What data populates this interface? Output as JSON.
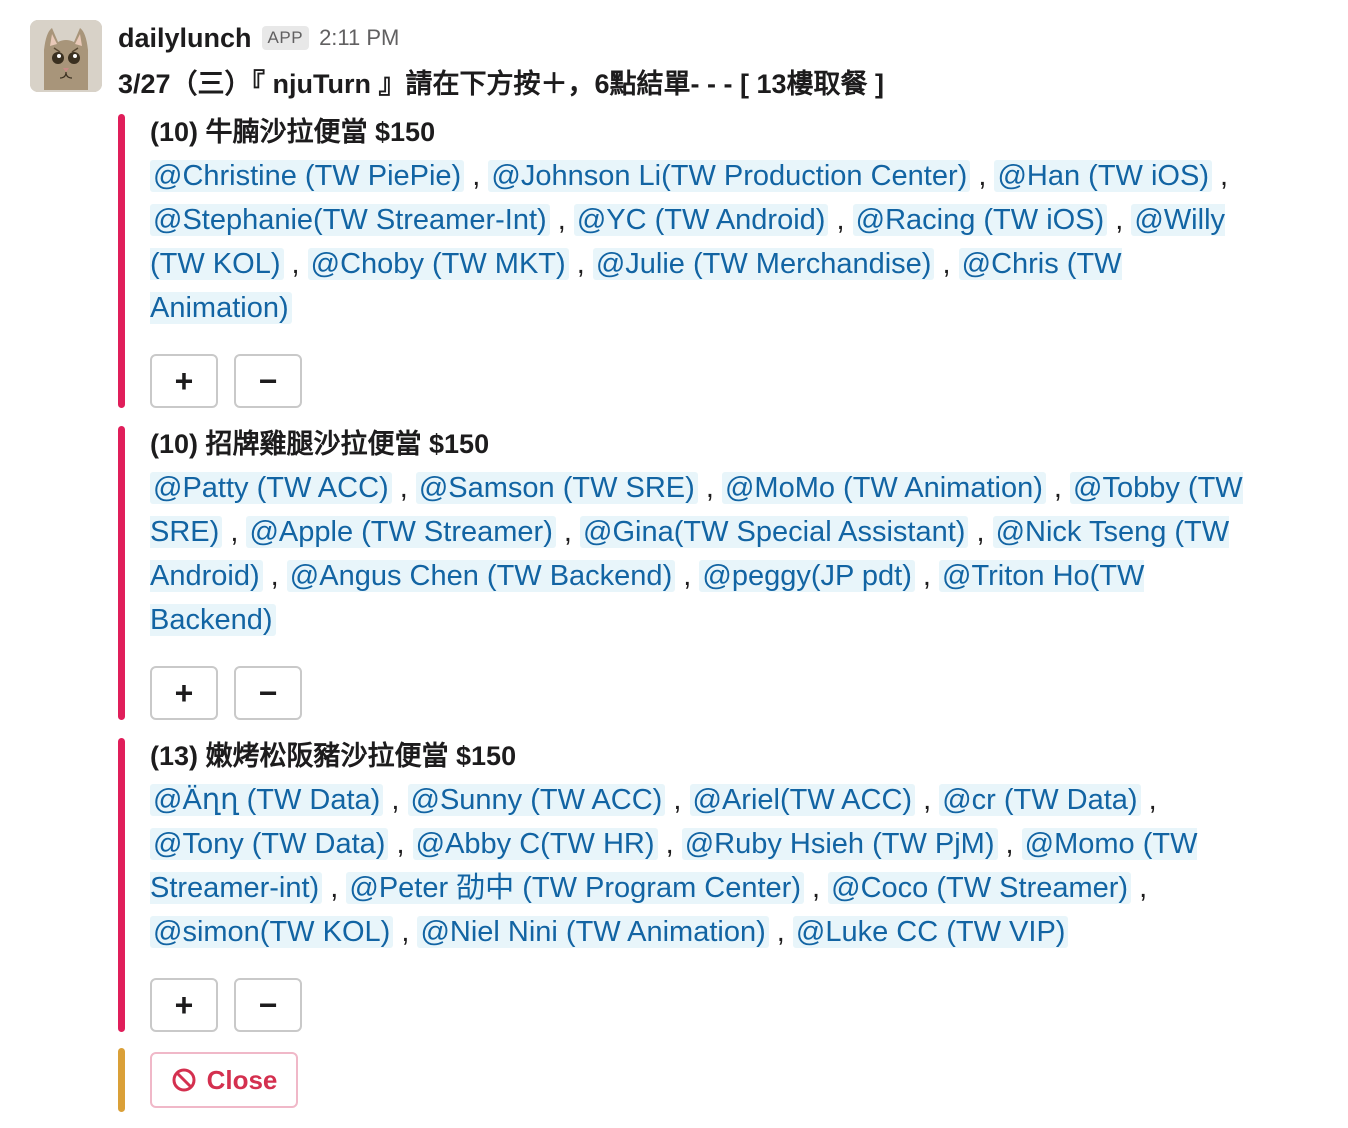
{
  "message": {
    "username": "dailylunch",
    "badge": "APP",
    "time": "2:11 PM",
    "text": "3/27（三）『 njuTurn 』請在下方按＋，6點結單- - - [ 13樓取餐 ]"
  },
  "attachments": [
    {
      "title": "(10) 牛腩沙拉便當 $150",
      "color": "#e01e5a",
      "mentions": [
        "@Christine (TW PiePie)",
        "@Johnson Li(TW Production Center)",
        "@Han (TW iOS)",
        "@Stephanie(TW Streamer-Int)",
        "@YC (TW Android)",
        "@Racing (TW iOS)",
        "@Willy (TW KOL)",
        "@Choby (TW MKT)",
        "@Julie (TW Merchandise)",
        "@Chris (TW Animation)"
      ],
      "plus": "+",
      "minus": "−"
    },
    {
      "title": "(10) 招牌雞腿沙拉便當 $150",
      "color": "#e01e5a",
      "mentions": [
        "@Patty (TW ACC)",
        "@Samson (TW SRE)",
        "@MoMo (TW Animation)",
        "@Tobby (TW SRE)",
        "@Apple (TW Streamer)",
        "@Gina(TW Special Assistant)",
        "@Nick Tseng (TW Android)",
        "@Angus Chen (TW Backend)",
        "@peggy(JP pdt)",
        "@Triton Ho(TW Backend)"
      ],
      "plus": "+",
      "minus": "−"
    },
    {
      "title": "(13) 嫩烤松阪豬沙拉便當 $150",
      "color": "#e01e5a",
      "mentions": [
        "@Äղղ (TW Data)",
        "@Sunny (TW ACC)",
        "@Ariel(TW ACC)",
        "@cr (TW Data)",
        "@Tony (TW Data)",
        "@Abby C(TW HR)",
        "@Ruby Hsieh (TW PjM)",
        "@Momo (TW Streamer-int)",
        "@Peter 劭中 (TW Program Center)",
        "@Coco (TW Streamer)",
        "@simon(TW KOL)",
        "@Niel Nini (TW Animation)",
        "@Luke CC (TW VIP)"
      ],
      "plus": "+",
      "minus": "−"
    }
  ],
  "close": {
    "label": "Close",
    "icon": "no-entry-icon",
    "bar_color": "#daa038"
  },
  "colors": {
    "mention_text": "#1264a3",
    "mention_bg": "#e8f5fa",
    "close_text": "#d4304f"
  }
}
